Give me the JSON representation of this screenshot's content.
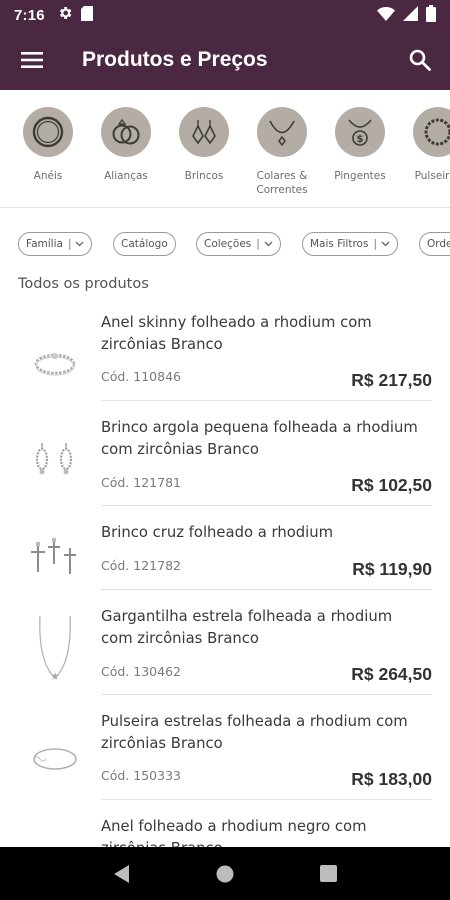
{
  "status_bar": {
    "time": "7:16"
  },
  "app_bar": {
    "title": "Produtos e Preços"
  },
  "categories": [
    {
      "label": "Anéis",
      "icon": "ring-icon"
    },
    {
      "label": "Alianças",
      "icon": "wedding-rings-icon"
    },
    {
      "label": "Brincos",
      "icon": "earrings-icon"
    },
    {
      "label": "Colares &\nCorrentes",
      "icon": "necklace-icon"
    },
    {
      "label": "Pingentes",
      "icon": "pendant-icon"
    },
    {
      "label": "Pulseiras",
      "icon": "bracelet-icon"
    }
  ],
  "filters": [
    {
      "label": "Família",
      "has_dropdown": true
    },
    {
      "label": "Catálogo",
      "has_dropdown": false
    },
    {
      "label": "Coleções",
      "has_dropdown": true
    },
    {
      "label": "Mais Filtros",
      "has_dropdown": true
    },
    {
      "label": "Ordenar",
      "has_dropdown": true
    }
  ],
  "section_title": "Todos os produtos",
  "products": [
    {
      "name": "Anel skinny folheado a rhodium com zircônias Branco",
      "code": "Cód. 110846",
      "price": "R$ 217,50"
    },
    {
      "name": "Brinco argola pequena folheada a rhodium com zircônias Branco",
      "code": "Cód. 121781",
      "price": "R$ 102,50"
    },
    {
      "name": "Brinco cruz folheado a rhodium",
      "code": "Cód. 121782",
      "price": "R$ 119,90"
    },
    {
      "name": "Gargantilha estrela folheada a rhodium com zircônias Branco",
      "code": "Cód. 130462",
      "price": "R$ 264,50"
    },
    {
      "name": "Pulseira estrelas folheada a rhodium com zircônias Branco",
      "code": "Cód. 150333",
      "price": "R$ 183,00"
    },
    {
      "name": "Anel folheado a rhodium negro com zircônias Branco",
      "code": "",
      "price": ""
    }
  ],
  "colors": {
    "primary": "#4a2842",
    "category_circle": "#b3ada6"
  }
}
